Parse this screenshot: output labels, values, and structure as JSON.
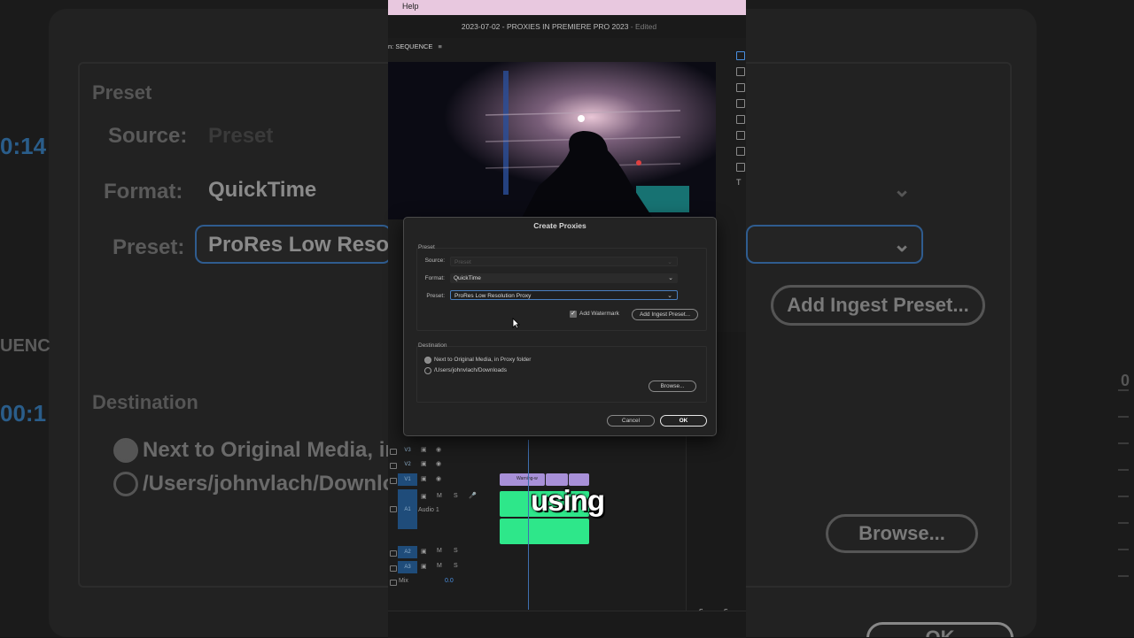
{
  "menu": {
    "help": "Help"
  },
  "window": {
    "title": "2023-07-02 - PROXIES IN PREMIERE PRO 2023",
    "edited": " - Edited"
  },
  "program_monitor": {
    "label": "n: SEQUENCE",
    "menu_icon": "hamburger-icon"
  },
  "dialog": {
    "title": "Create Proxies",
    "preset_group": "Preset",
    "source_label": "Source:",
    "source_value": "Preset",
    "format_label": "Format:",
    "format_value": "QuickTime",
    "preset_label": "Preset:",
    "preset_value": "ProRes Low Resolution Proxy",
    "watermark_label": "Add Watermark",
    "watermark_checked": true,
    "add_ingest_button": "Add Ingest Preset...",
    "destination_group": "Destination",
    "dest_option_1": "Next to Original Media, in Proxy folder",
    "dest_option_2": "/Users/johnvlach/Downloads",
    "browse_button": "Browse...",
    "cancel_button": "Cancel",
    "ok_button": "OK",
    "colors": {
      "accent": "#4a7fbf",
      "bg": "#232323"
    }
  },
  "timeline": {
    "tracks": {
      "v3": "V3",
      "v2": "V2",
      "v1": "V1",
      "a1": "A1",
      "a1_name": "Audio 1",
      "a2": "A2",
      "a3": "A3",
      "mix": "Mix",
      "mix_value": "0.0"
    },
    "clip_label": "Warning-w",
    "m": "M",
    "s": "S",
    "caption": "using"
  },
  "side_panel": {
    "s1": "S",
    "s2": "S"
  },
  "background": {
    "preset": "Preset",
    "source": "Source:",
    "source_value": "Preset",
    "format": "Format:",
    "format_value": "QuickTime",
    "preset_label": "Preset:",
    "preset_value": "ProRes Low Resolut",
    "destination": "Destination",
    "dest1": "Next to Original Media, in P",
    "dest2": "/Users/johnvlach/Downloa",
    "add_ingest": "Add Ingest Preset...",
    "browse": "Browse...",
    "ok": "OK",
    "timecode1": "0:14",
    "timecode2": "00:1",
    "seq": "UENC",
    "scale": "0"
  }
}
